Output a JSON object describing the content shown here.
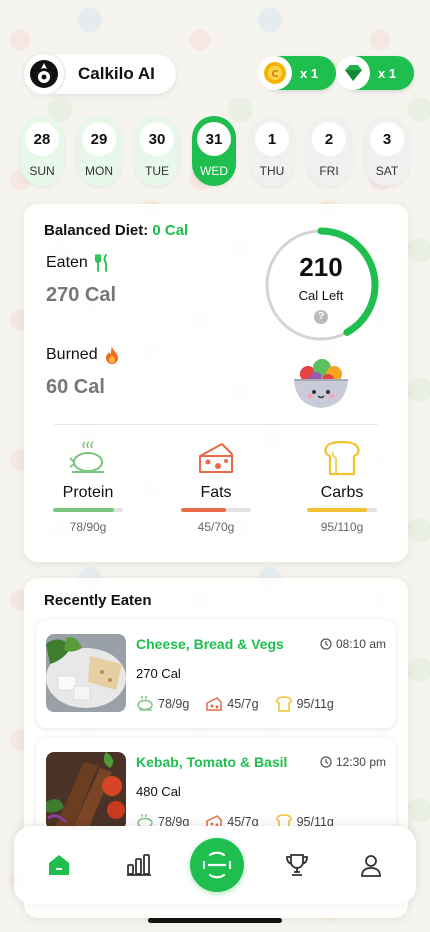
{
  "app": {
    "name": "Calkilo AI"
  },
  "counters": [
    {
      "icon": "coin-icon",
      "value": "x 1"
    },
    {
      "icon": "gem-icon",
      "value": "x 1"
    }
  ],
  "days": [
    {
      "num": "28",
      "name": "SUN",
      "state": "past"
    },
    {
      "num": "29",
      "name": "MON",
      "state": "past"
    },
    {
      "num": "30",
      "name": "TUE",
      "state": "past"
    },
    {
      "num": "31",
      "name": "WED",
      "state": "active"
    },
    {
      "num": "1",
      "name": "THU",
      "state": "future"
    },
    {
      "num": "2",
      "name": "FRI",
      "state": "future"
    },
    {
      "num": "3",
      "name": "SAT",
      "state": "future"
    }
  ],
  "summary": {
    "title": "Balanced Diet:",
    "title_value": "0 Cal",
    "eaten_label": "Eaten",
    "eaten_value": "270 Cal",
    "burned_label": "Burned",
    "burned_value": "60 Cal",
    "cal_left_value": "210",
    "cal_left_label": "Cal Left",
    "help": "?",
    "ring_progress": 0.42
  },
  "macros": [
    {
      "name": "Protein",
      "value": "78/90g",
      "progress": 0.87,
      "color": "#7cc57f"
    },
    {
      "name": "Fats",
      "value": "45/70g",
      "progress": 0.64,
      "color": "#e96a4a"
    },
    {
      "name": "Carbs",
      "value": "95/110g",
      "progress": 0.86,
      "color": "#f1c232"
    }
  ],
  "recent": {
    "title": "Recently Eaten",
    "meals": [
      {
        "name": "Cheese, Bread & Vegs",
        "time": "08:10 am",
        "cal": "270 Cal",
        "protein": "78/9g",
        "fats": "45/7g",
        "carbs": "95/11g"
      },
      {
        "name": "Kebab, Tomato & Basil",
        "time": "12:30 pm",
        "cal": "480 Cal",
        "protein": "78/9g",
        "fats": "45/7g",
        "carbs": "95/11g"
      }
    ]
  },
  "colors": {
    "accent": "#1fbf4f",
    "protein": "#7cc57f",
    "fats": "#e96a4a",
    "carbs": "#f1c232"
  }
}
